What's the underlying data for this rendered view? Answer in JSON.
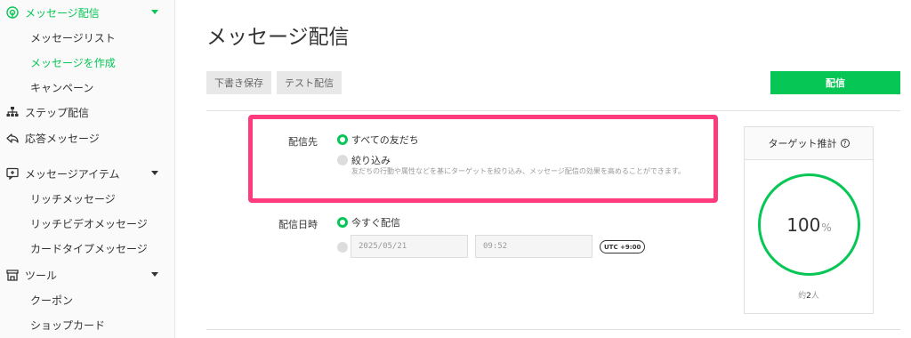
{
  "sidebar": {
    "items": [
      {
        "label": "メッセージ配信",
        "type": "top",
        "icon": "broadcast-icon",
        "active": true,
        "caret": true
      },
      {
        "label": "メッセージリスト",
        "type": "sub"
      },
      {
        "label": "メッセージを作成",
        "type": "sub",
        "active": true
      },
      {
        "label": "キャンペーン",
        "type": "sub"
      },
      {
        "label": "ステップ配信",
        "type": "top",
        "icon": "hierarchy-icon"
      },
      {
        "label": "応答メッセージ",
        "type": "top",
        "icon": "reply-icon"
      },
      {
        "label": "メッセージアイテム",
        "type": "top",
        "icon": "message-add-icon",
        "caret": true
      },
      {
        "label": "リッチメッセージ",
        "type": "sub"
      },
      {
        "label": "リッチビデオメッセージ",
        "type": "sub"
      },
      {
        "label": "カードタイプメッセージ",
        "type": "sub"
      },
      {
        "label": "ツール",
        "type": "top",
        "icon": "store-icon",
        "caret": true
      },
      {
        "label": "クーポン",
        "type": "sub"
      },
      {
        "label": "ショップカード",
        "type": "sub"
      }
    ]
  },
  "page": {
    "title": "メッセージ配信"
  },
  "toolbar": {
    "draft_label": "下書き保存",
    "test_label": "テスト配信",
    "send_label": "配信"
  },
  "recipients": {
    "label": "配信先",
    "all_label": "すべての友だち",
    "filter_label": "絞り込み",
    "filter_desc": "友だちの行動や属性などを基にターゲットを絞り込み、メッセージ配信の効果を高めることができます。"
  },
  "schedule": {
    "label": "配信日時",
    "now_label": "今すぐ配信",
    "date_placeholder": "2025/05/21",
    "time_placeholder": "09:52",
    "timezone": "UTC +9:00"
  },
  "target": {
    "title": "ターゲット推計",
    "help_icon": "?",
    "percent": "100",
    "percent_unit": "%",
    "count_prefix": "約",
    "count": "2",
    "count_unit": "人"
  },
  "colors": {
    "accent": "#06c755",
    "highlight": "#ff3a7d"
  }
}
